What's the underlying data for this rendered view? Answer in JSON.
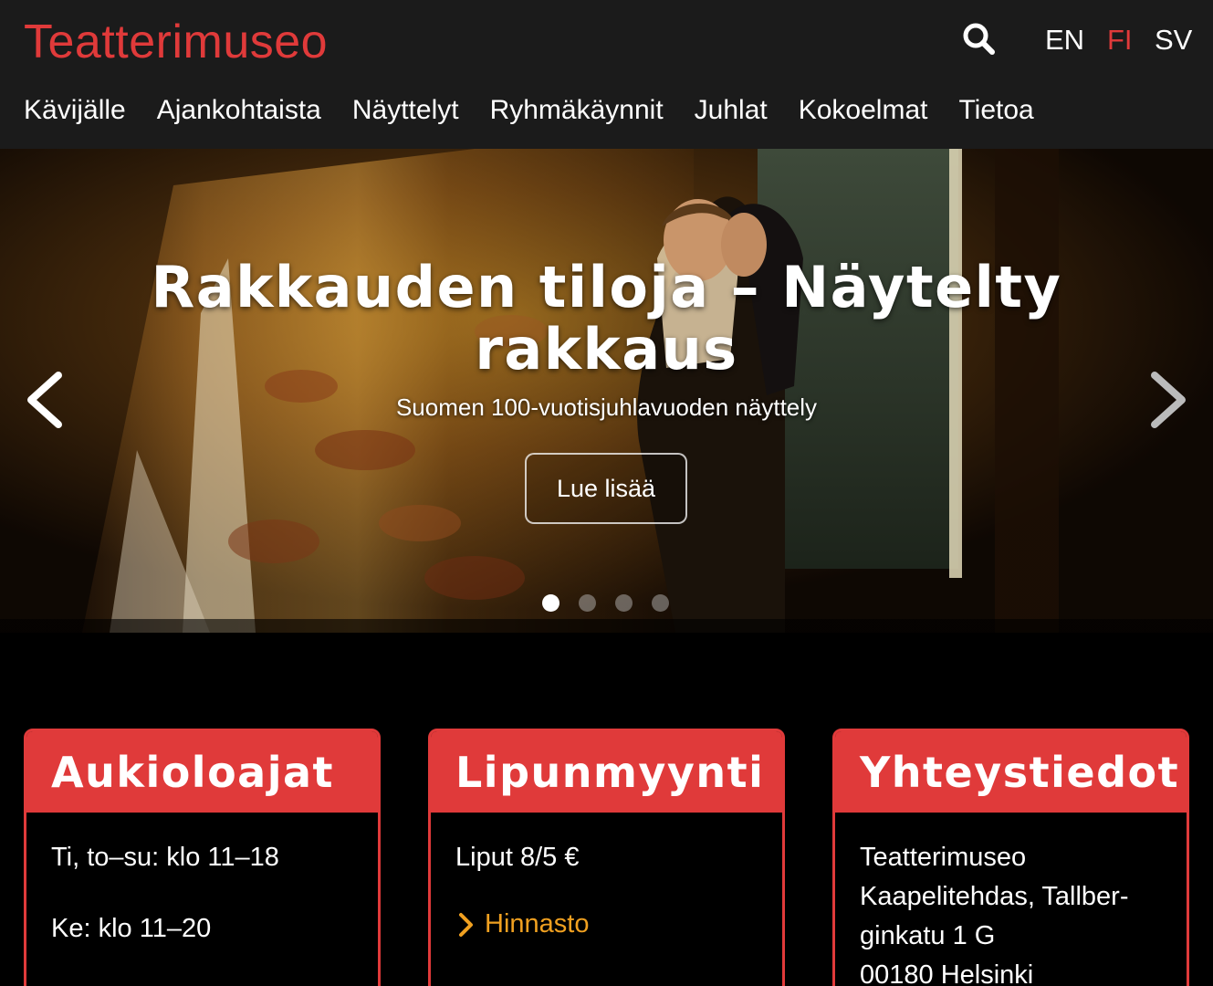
{
  "header": {
    "logo": "Teatterimuseo",
    "languages": [
      {
        "label": "EN",
        "active": false
      },
      {
        "label": "FI",
        "active": true
      },
      {
        "label": "SV",
        "active": false
      }
    ],
    "nav": [
      "Kävijälle",
      "Ajankohtaista",
      "Näyttelyt",
      "Ryhmäkäynnit",
      "Juhlat",
      "Kokoelmat",
      "Tietoa"
    ]
  },
  "hero": {
    "title_line1": "Rakkauden tiloja – Näytelty",
    "title_line2": "rakkaus",
    "subtitle": "Suomen 100-vuotisjuhlavuoden näyttely",
    "button": "Lue lisää",
    "slides_count": 4,
    "active_slide": 1
  },
  "cards": {
    "hours": {
      "title": "Aukioloajat",
      "lines": [
        "Ti, to–su: klo 11–18",
        "Ke: klo 11–20"
      ]
    },
    "tickets": {
      "title": "Lipunmyynti",
      "price": "Liput 8/5 €",
      "link": "Hinnasto"
    },
    "contact": {
      "title": "Yhteystiedot",
      "lines": [
        "Teatterimuseo",
        "Kaapelitehdas, Tallber-",
        "ginkatu 1 G",
        "00180 Helsinki"
      ]
    }
  },
  "colors": {
    "brand_red": "#e03a3a",
    "link_orange": "#f0a020",
    "header_bg": "#1b1b1b"
  }
}
